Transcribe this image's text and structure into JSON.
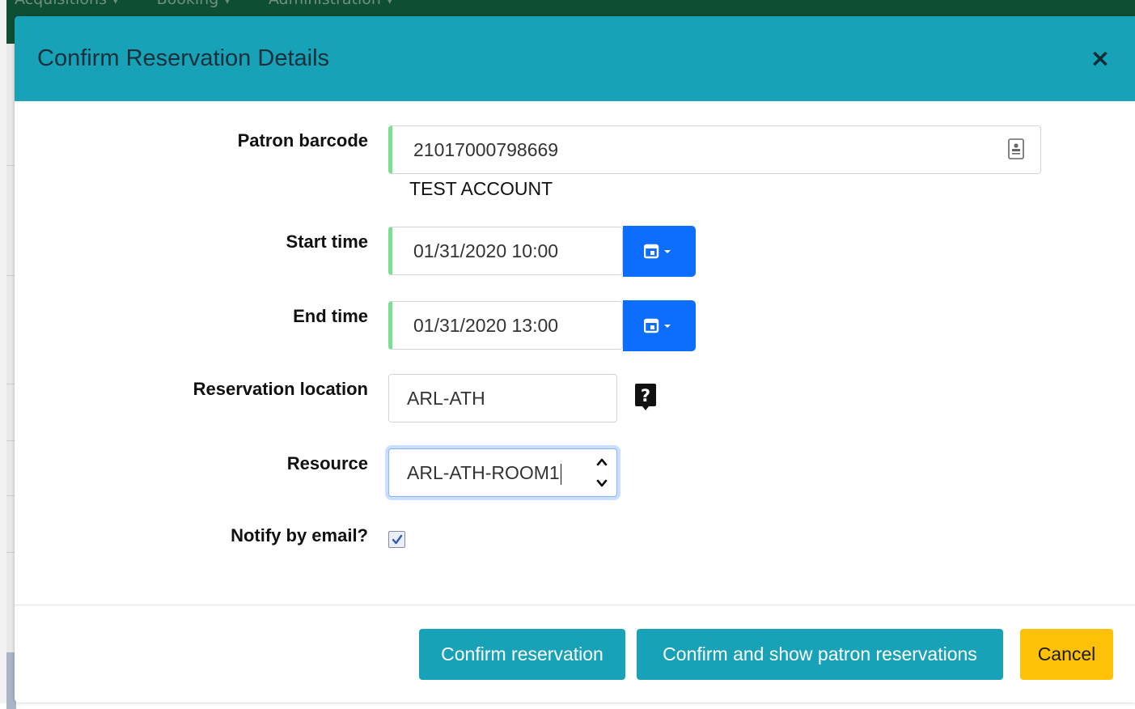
{
  "background": {
    "nav_items": [
      "Acquisitions ▾",
      "Booking ▾",
      "Administration ▾"
    ]
  },
  "modal": {
    "title": "Confirm Reservation Details",
    "close_glyph": "×"
  },
  "form": {
    "patron_barcode": {
      "label": "Patron barcode",
      "value": "21017000798669",
      "patron_name": "TEST ACCOUNT"
    },
    "start_time": {
      "label": "Start time",
      "value": "01/31/2020 10:00"
    },
    "end_time": {
      "label": "End time",
      "value": "01/31/2020 13:00"
    },
    "reservation_location": {
      "label": "Reservation location",
      "value": "ARL-ATH"
    },
    "resource": {
      "label": "Resource",
      "value": "ARL-ATH-ROOM1"
    },
    "notify_email": {
      "label": "Notify by email?",
      "checked": true
    }
  },
  "footer": {
    "confirm_label": "Confirm reservation",
    "confirm_show_label": "Confirm and show patron reservations",
    "cancel_label": "Cancel"
  },
  "colors": {
    "header": "#17a2b8",
    "primary_button": "#0d6efd",
    "info_button": "#17a2b8",
    "warning_button": "#ffc107",
    "valid_indicator": "#78e08f"
  },
  "icons": {
    "barcode_field": "contact-card-icon",
    "calendar": "calendar-icon",
    "help": "help-icon"
  }
}
